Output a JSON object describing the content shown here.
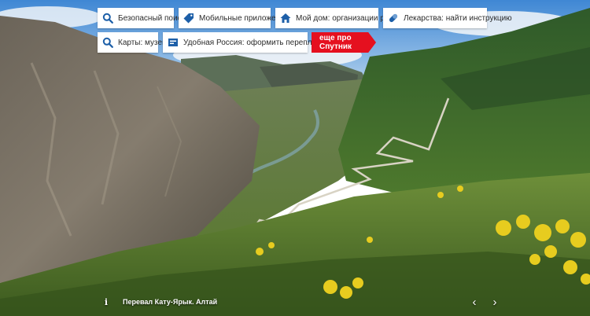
{
  "links": {
    "safe_search": "Безопасный поиск",
    "mobile_apps": "Мобильные приложения",
    "my_home": "Мой дом: организации рядом",
    "medicines": "Лекарства: найти инструкцию",
    "maps_museum": "Карты: музеи",
    "convenient_russia": "Удобная Россия: оформить перепланировку",
    "more_sputnik": "еще про Спутник"
  },
  "photo": {
    "info_icon": "i",
    "caption": "Перевал Кату-Ярык. Алтай"
  },
  "nav": {
    "prev": "‹",
    "next": "›"
  },
  "colors": {
    "accent_red": "#e5101f",
    "icon_blue": "#1d5fa8"
  }
}
